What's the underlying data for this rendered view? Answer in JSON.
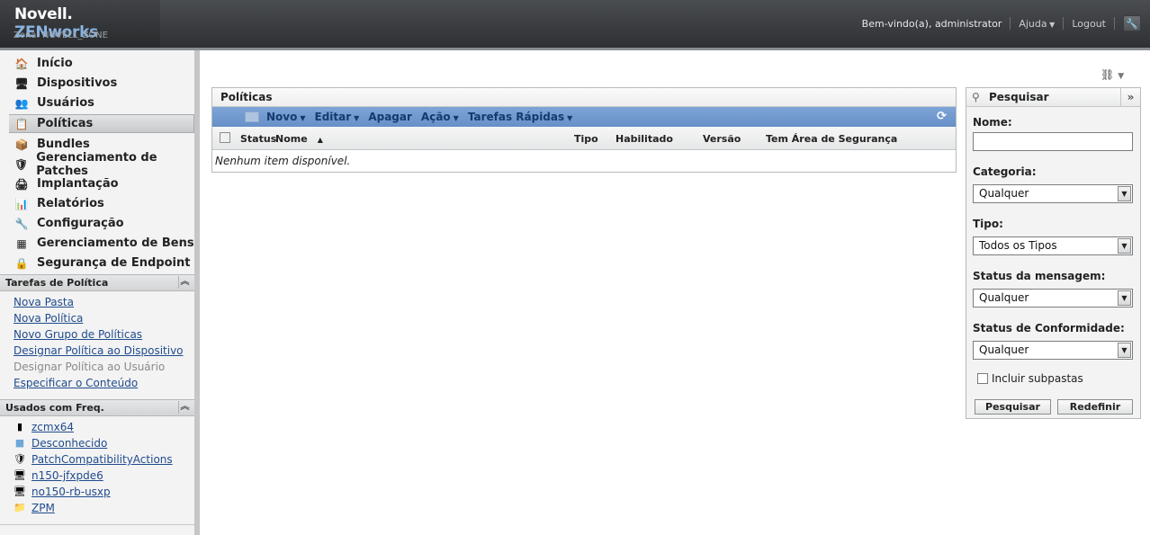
{
  "header": {
    "logo_novell": "Novell.",
    "logo_zen": "ZENworks",
    "zone": "Zona: NOVELL_ZONE",
    "welcome": "Bem-vindo(a), administrator",
    "help": "Ajuda",
    "logout": "Logout"
  },
  "nav": {
    "items": [
      {
        "label": "Início",
        "icon": "home-icon"
      },
      {
        "label": "Dispositivos",
        "icon": "monitor-icon"
      },
      {
        "label": "Usuários",
        "icon": "users-icon"
      },
      {
        "label": "Políticas",
        "icon": "policy-icon",
        "active": true
      },
      {
        "label": "Bundles",
        "icon": "bundle-icon"
      },
      {
        "label": "Gerenciamento de Patches",
        "icon": "shield-icon"
      },
      {
        "label": "Implantação",
        "icon": "deploy-icon"
      },
      {
        "label": "Relatórios",
        "icon": "report-icon"
      },
      {
        "label": "Configuração",
        "icon": "wrench-icon"
      },
      {
        "label": "Gerenciamento de Bens",
        "icon": "asset-icon"
      },
      {
        "label": "Segurança de Endpoint",
        "icon": "lock-icon"
      }
    ]
  },
  "tasks": {
    "title": "Tarefas de Política",
    "links": [
      {
        "label": "Nova Pasta",
        "enabled": true
      },
      {
        "label": "Nova Política",
        "enabled": true
      },
      {
        "label": "Novo Grupo de Políticas",
        "enabled": true
      },
      {
        "label": "Designar Política ao Dispositivo",
        "enabled": true
      },
      {
        "label": "Designar Política ao Usuário",
        "enabled": false
      },
      {
        "label": "Especificar o Conteúdo",
        "enabled": true
      }
    ]
  },
  "frequent": {
    "title": "Usados com Freq.",
    "items": [
      {
        "label": "zcmx64",
        "icon": "server-icon"
      },
      {
        "label": "Desconhecido",
        "icon": "cube-icon"
      },
      {
        "label": "PatchCompatibilityActions",
        "icon": "shield-icon"
      },
      {
        "label": "n150-jfxpde6",
        "icon": "monitor-icon"
      },
      {
        "label": "no150-rb-usxp",
        "icon": "monitor-icon"
      },
      {
        "label": "ZPM",
        "icon": "folder-icon"
      }
    ]
  },
  "policies": {
    "title": "Políticas",
    "toolbar": {
      "new": "Novo",
      "edit": "Editar",
      "delete": "Apagar",
      "action": "Ação",
      "quick_tasks": "Tarefas Rápidas"
    },
    "columns": {
      "status": "Status",
      "name": "Nome",
      "type": "Tipo",
      "enabled": "Habilitado",
      "version": "Versão",
      "sandbox": "Tem Área de Segurança"
    },
    "empty": "Nenhum item disponível."
  },
  "search": {
    "title": "Pesquisar",
    "name_label": "Nome:",
    "name_value": "",
    "category_label": "Categoria:",
    "category_value": "Qualquer",
    "type_label": "Tipo:",
    "type_value": "Todos os Tipos",
    "msg_status_label": "Status da mensagem:",
    "msg_status_value": "Qualquer",
    "compliance_label": "Status de Conformidade:",
    "compliance_value": "Qualquer",
    "include_subfolders": "Incluir subpastas",
    "search_button": "Pesquisar",
    "reset_button": "Redefinir"
  }
}
